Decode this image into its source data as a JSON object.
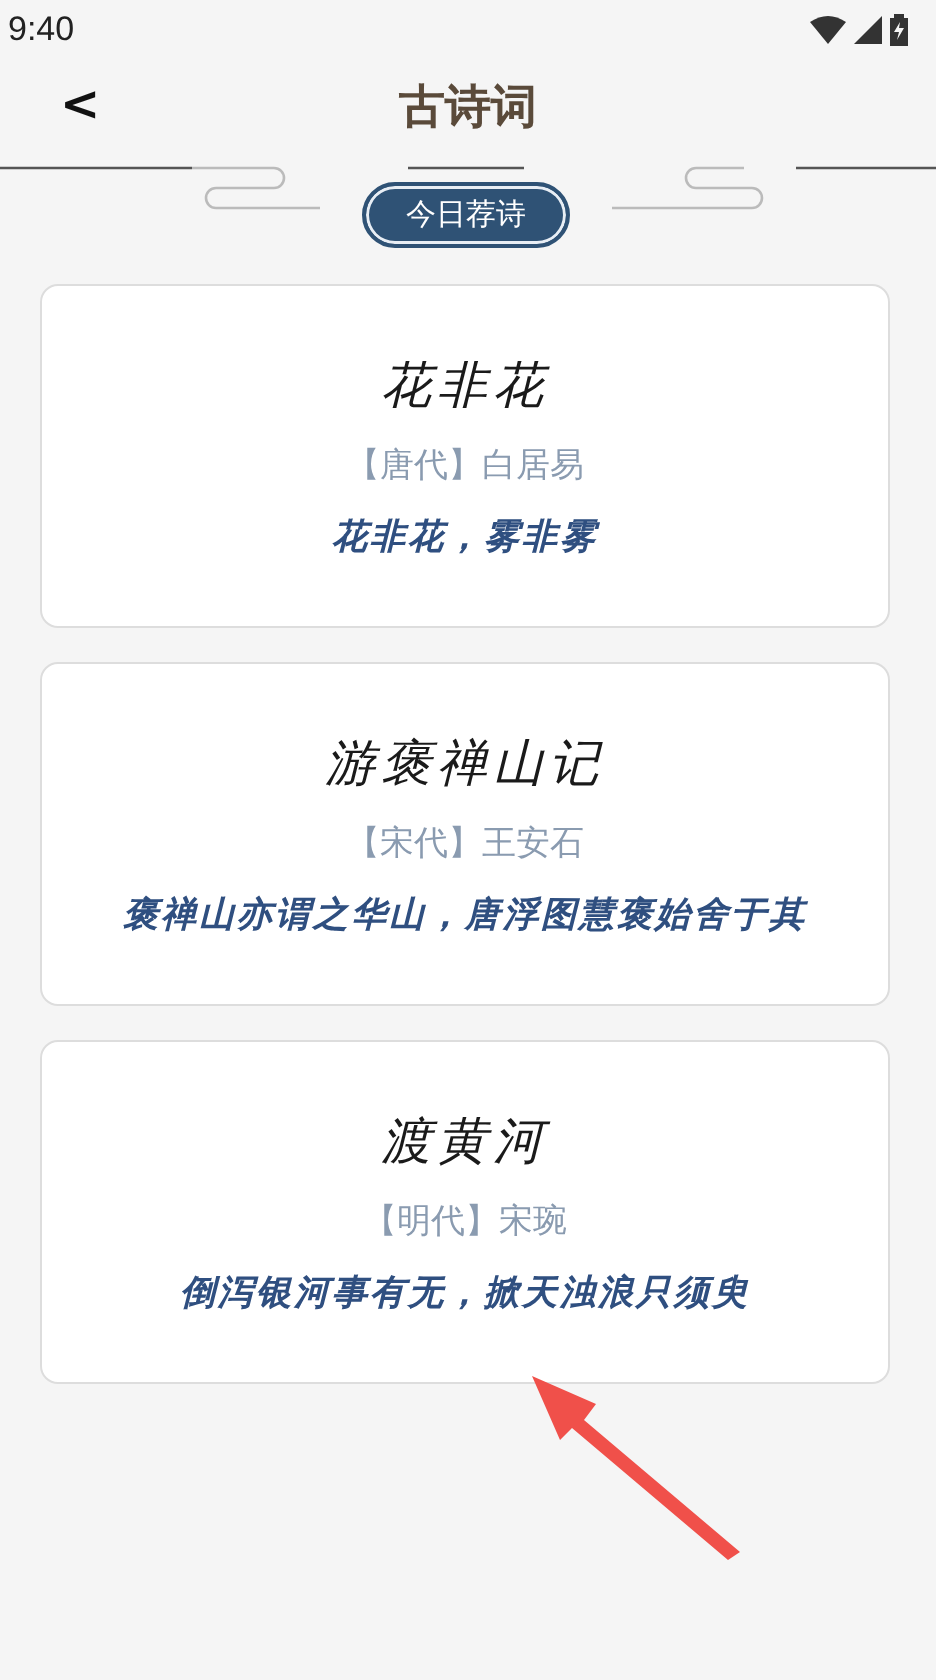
{
  "status_bar": {
    "time": "9:40"
  },
  "header": {
    "back": "<",
    "title": "古诗词"
  },
  "badge": "今日荐诗",
  "poems": [
    {
      "title": "花非花",
      "author": "【唐代】白居易",
      "line": "花非花，雾非雾"
    },
    {
      "title": "游褒禅山记",
      "author": "【宋代】王安石",
      "line": "褒禅山亦谓之华山，唐浮图慧褒始舍于其"
    },
    {
      "title": "渡黄河",
      "author": "【明代】宋琬",
      "line": "倒泻银河事有无，掀天浊浪只须臾"
    }
  ]
}
